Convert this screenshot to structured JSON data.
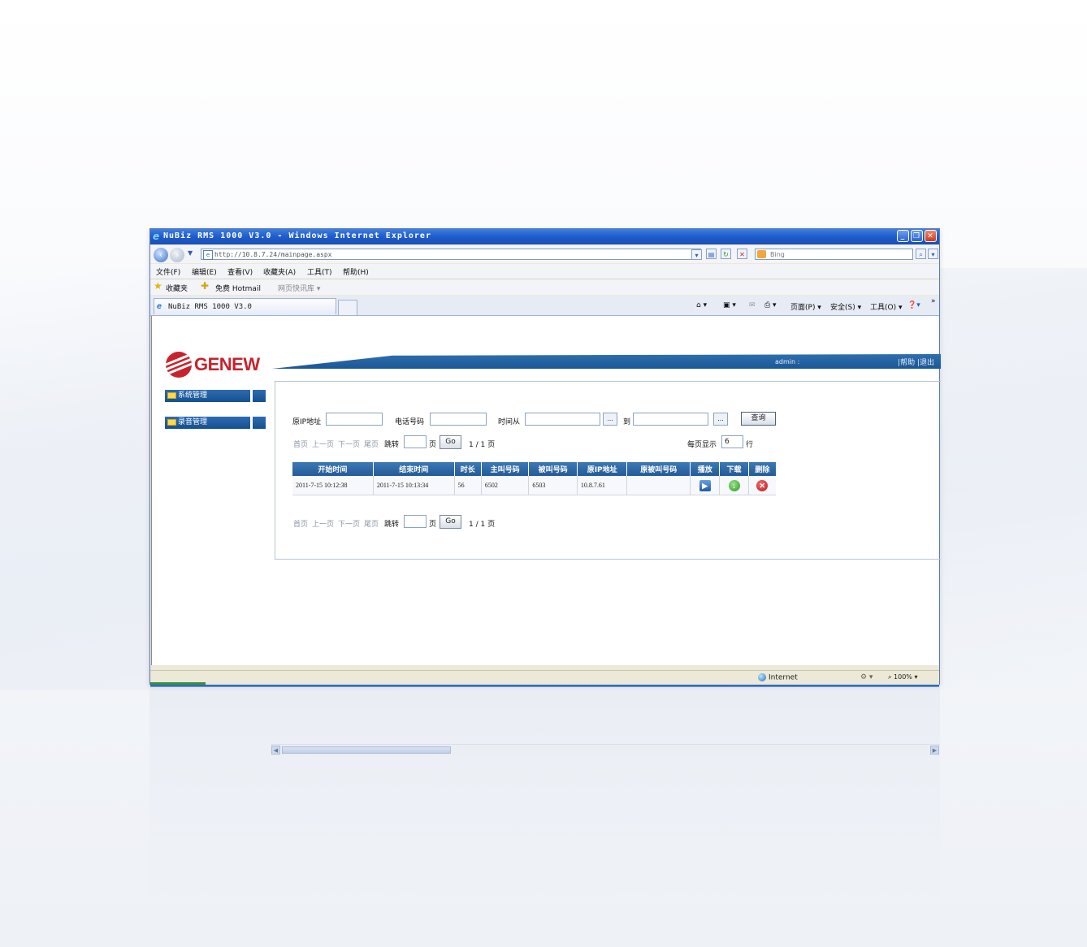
{
  "browser": {
    "window_title": "NuBiz RMS 1000 V3.0 - Windows Internet Explorer",
    "url": "http://10.8.7.24/mainpage.aspx",
    "search_placeholder": "Bing",
    "menu": [
      "文件(F)",
      "编辑(E)",
      "查看(V)",
      "收藏夹(A)",
      "工具(T)",
      "帮助(H)"
    ],
    "favorites": {
      "label": "收藏夹",
      "item1": "免费 Hotmail",
      "item2": "网页快讯库 ▾"
    },
    "tab_title": "NuBiz RMS 1000 V3.0",
    "commands": {
      "page": "页面(P) ▾",
      "safety": "安全(S) ▾",
      "tools": "工具(O) ▾",
      "more": "»"
    },
    "status": {
      "zone": "Internet",
      "zoom": "100%",
      "load_progress_percent": 7
    }
  },
  "app": {
    "logo_text": "GENEW",
    "user": "admin :",
    "header_links": "|帮助 |退出",
    "sidebar": [
      {
        "label": "系统管理"
      },
      {
        "label": "录音管理"
      }
    ],
    "filters": {
      "source_ip_label": "原IP地址",
      "phone_label": "电话号码",
      "time_from_label": "时间从",
      "time_to_label": "到",
      "picker_label": "...",
      "query_button": "查询"
    },
    "pager": {
      "first": "首页",
      "prev": "上一页",
      "next": "下一页",
      "last": "尾页",
      "jump_label": "跳转",
      "page_unit": "页",
      "go": "Go",
      "page_info": "1 / 1 页",
      "per_page_label": "每页显示",
      "per_page_value": "6",
      "row_unit": "行"
    },
    "table": {
      "columns": [
        "开始时间",
        "结束时间",
        "时长",
        "主叫号码",
        "被叫号码",
        "原IP地址",
        "原被叫号码",
        "播放",
        "下载",
        "删除"
      ],
      "rows": [
        {
          "start": "2011-7-15 10:12:38",
          "end": "2011-7-15 10:13:34",
          "duration": "56",
          "caller": "6502",
          "callee": "6503",
          "source_ip": "10.8.7.61",
          "orig_callee": ""
        }
      ]
    }
  },
  "colors": {
    "brand_red": "#c8232c",
    "header_blue": "#235c98",
    "titlebar_blue": "#1f5ccc"
  }
}
